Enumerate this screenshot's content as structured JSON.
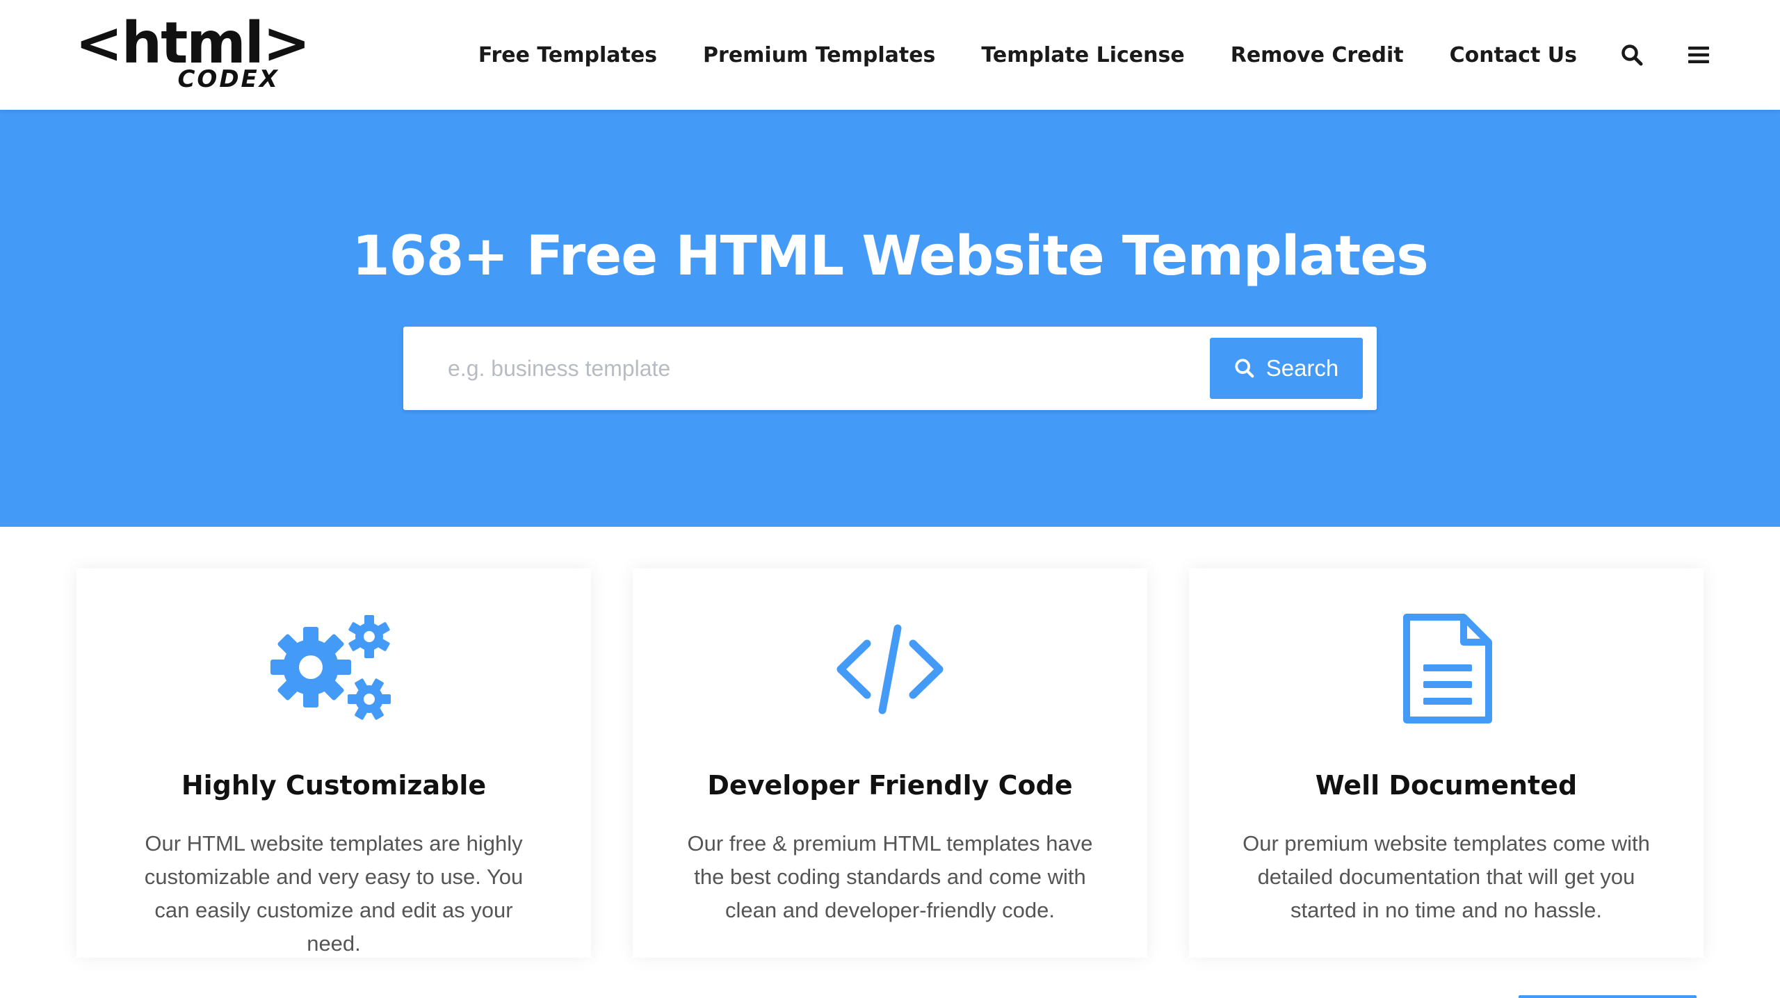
{
  "brand": {
    "logo_main": "<html>",
    "logo_sub": "CODEX"
  },
  "nav": {
    "items": [
      {
        "label": "Free Templates"
      },
      {
        "label": "Premium Templates"
      },
      {
        "label": "Template License"
      },
      {
        "label": "Remove Credit"
      },
      {
        "label": "Contact Us"
      }
    ],
    "icons": [
      "search-icon",
      "hamburger-menu-icon"
    ]
  },
  "hero": {
    "title": "168+ Free HTML Website Templates",
    "search": {
      "placeholder": "e.g. business template",
      "value": "",
      "button_label": "Search",
      "button_icon": "search-icon"
    }
  },
  "features": [
    {
      "icon": "gears-icon",
      "title": "Highly Customizable",
      "text": "Our HTML website templates are highly customizable and very easy to use. You can easily customize and edit as your need."
    },
    {
      "icon": "code-icon",
      "title": "Developer Friendly Code",
      "text": "Our free & premium HTML templates have the best coding standards and come with clean and developer-friendly code."
    },
    {
      "icon": "document-icon",
      "title": "Well Documented",
      "text": "Our premium website templates come with detailed documentation that will get you started in no time and no hassle."
    }
  ],
  "colors": {
    "accent": "#439af7",
    "text_dark": "#111111",
    "text_muted": "#555555",
    "placeholder": "#b8bcc2"
  }
}
